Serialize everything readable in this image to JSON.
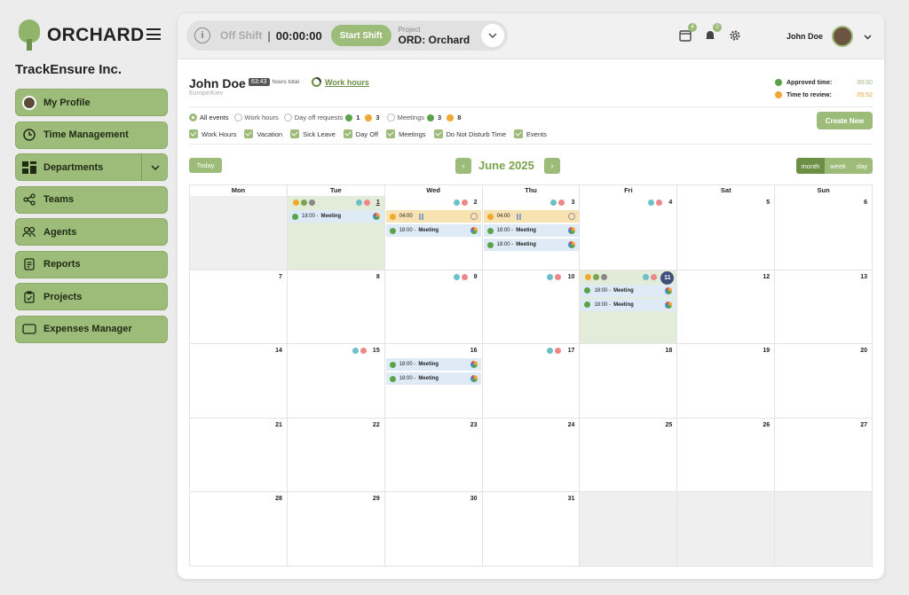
{
  "brand": {
    "name": "ORCHARD",
    "company": "TrackEnsure Inc."
  },
  "sidebar": {
    "items": [
      {
        "label": "My Profile",
        "icon": "avatar-icon"
      },
      {
        "label": "Time Management",
        "icon": "clock-icon"
      },
      {
        "label": "Departments",
        "icon": "grid-icon",
        "has_dropdown": true
      },
      {
        "label": "Teams",
        "icon": "share-icon"
      },
      {
        "label": "Agents",
        "icon": "people-icon"
      },
      {
        "label": "Reports",
        "icon": "document-icon"
      },
      {
        "label": "Projects",
        "icon": "clipboard-icon"
      },
      {
        "label": "Expenses Manager",
        "icon": "folder-icon"
      }
    ]
  },
  "topbar": {
    "shift_status": "Off Shift",
    "separator": "|",
    "timer": "00:00:00",
    "start_label": "Start Shift",
    "project_label": "Project",
    "project_value": "ORD: Orchard",
    "notif_badge_1": "4",
    "notif_badge_2": "0",
    "user_name": "John Doe"
  },
  "header": {
    "name": "John Doe",
    "hours_value": "63:43",
    "hours_suffix": "hours total",
    "work_hours_link": "Work hours",
    "timezone": "Europe/Kiev",
    "approved_label": "Approved time:",
    "approved_value": "00:00",
    "review_label": "Time to review:",
    "review_value": "05:52"
  },
  "filters": {
    "all": "All events",
    "work": "Work hours",
    "dayoff": "Day off requests",
    "dayoff_ok": "1",
    "dayoff_pending": "3",
    "meetings": "Meetings",
    "meetings_ok": "3",
    "meetings_pending": "8",
    "create": "Create New"
  },
  "checks": [
    "Work Hours",
    "Vacation",
    "Sick Leave",
    "Day Off",
    "Meetings",
    "Do Not Disturb Time",
    "Events"
  ],
  "calendar": {
    "today_label": "Today",
    "month": "June 2025",
    "views": [
      "month",
      "week",
      "day"
    ],
    "days": [
      "Mon",
      "Tue",
      "Wed",
      "Thu",
      "Fri",
      "Sat",
      "Sun"
    ],
    "weeks": [
      [
        "",
        "1",
        "2",
        "3",
        "4",
        "5",
        "6"
      ],
      [
        "7",
        "8",
        "9",
        "10",
        "11",
        "12",
        "13"
      ],
      [
        "14",
        "15",
        "16",
        "17",
        "18",
        "19",
        "20"
      ],
      [
        "21",
        "22",
        "23",
        "24",
        "25",
        "26",
        "27"
      ],
      [
        "28",
        "29",
        "30",
        "31",
        "",
        "",
        ""
      ]
    ],
    "ev_time": "18:00 -",
    "ev_title": "Meeting",
    "ev_work": "04:00"
  },
  "colors": {
    "accent": "#9dbb79",
    "accent_dark": "#6b8f45",
    "today": "#3d4f7a"
  }
}
